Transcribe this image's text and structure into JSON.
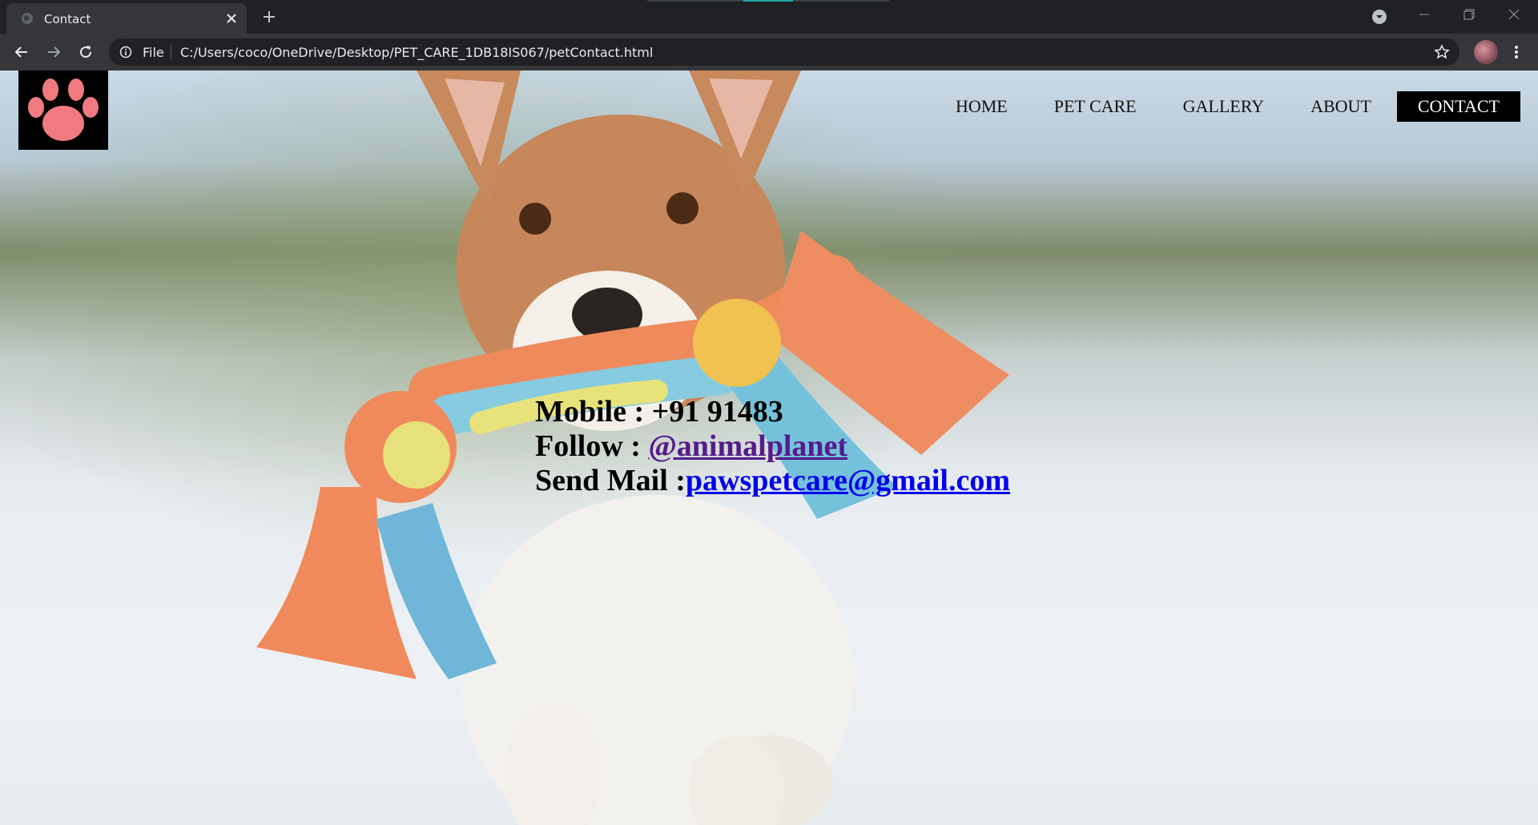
{
  "browser": {
    "tab_title": "Contact",
    "scheme": "File",
    "url": "C:/Users/coco/OneDrive/Desktop/PET_CARE_1DB18IS067/petContact.html"
  },
  "page": {
    "nav": [
      {
        "label": "HOME",
        "active": false
      },
      {
        "label": "PET CARE",
        "active": false
      },
      {
        "label": "GALLERY",
        "active": false
      },
      {
        "label": "ABOUT",
        "active": false
      },
      {
        "label": "CONTACT",
        "active": true
      }
    ],
    "contact": {
      "mobile_label": "Mobile : ",
      "mobile_value": "+91 91483",
      "follow_label": "Follow : ",
      "follow_link": "@animalplanet",
      "mail_label": "Send Mail :",
      "mail_link": "pawspetcare@gmail.com"
    }
  },
  "colors": {
    "logo_paw": "#f07a7f",
    "visited_link": "#551a8b",
    "link": "#0000ee"
  }
}
